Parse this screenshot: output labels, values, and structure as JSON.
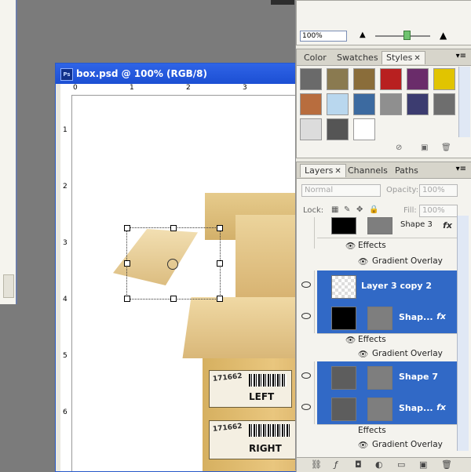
{
  "document": {
    "title": "box.psd @ 100% (RGB/8)",
    "ps_icon": "Ps",
    "ruler_top": [
      "0",
      "1",
      "2",
      "3"
    ],
    "ruler_left": [
      "1",
      "2",
      "3",
      "4",
      "5",
      "6"
    ]
  },
  "labels": {
    "left": {
      "code": "171662",
      "word": "LEFT"
    },
    "right": {
      "code": "171662",
      "word": "RIGHT"
    }
  },
  "navigator": {
    "zoom": "100%"
  },
  "styles_panel": {
    "tabs": [
      "Color",
      "Swatches",
      "Styles"
    ],
    "active_tab": "Styles",
    "swatches": [
      "#6a6a6a",
      "#8a7a50",
      "#8a6d3a",
      "#b82020",
      "#6a2c6a",
      "#e1c400",
      "#b86d3e",
      "#b9d7ee",
      "#3c6aa0",
      "#8f8f8f",
      "#3c3c70",
      "#6e6e6e",
      "#dcdcdc",
      "#555555",
      "#ffffff"
    ]
  },
  "layers_panel": {
    "tabs": [
      "Layers",
      "Channels",
      "Paths"
    ],
    "active_tab": "Layers",
    "blend_mode": "Normal",
    "opacity_label": "Opacity:",
    "opacity_value": "100%",
    "lock_label": "Lock:",
    "fill_label": "Fill:",
    "fill_value": "100%",
    "effects_label": "Effects",
    "gradient_overlay": "Gradient Overlay",
    "fx": "fx",
    "layers": [
      {
        "name": "Shape 3"
      },
      {
        "name": "Layer 3 copy 2"
      },
      {
        "name": "Shap..."
      },
      {
        "name": "Shape 7"
      },
      {
        "name": "Shap..."
      }
    ]
  },
  "colors": {
    "selection": "#3169c6",
    "titlebar": "#2f64e7"
  }
}
